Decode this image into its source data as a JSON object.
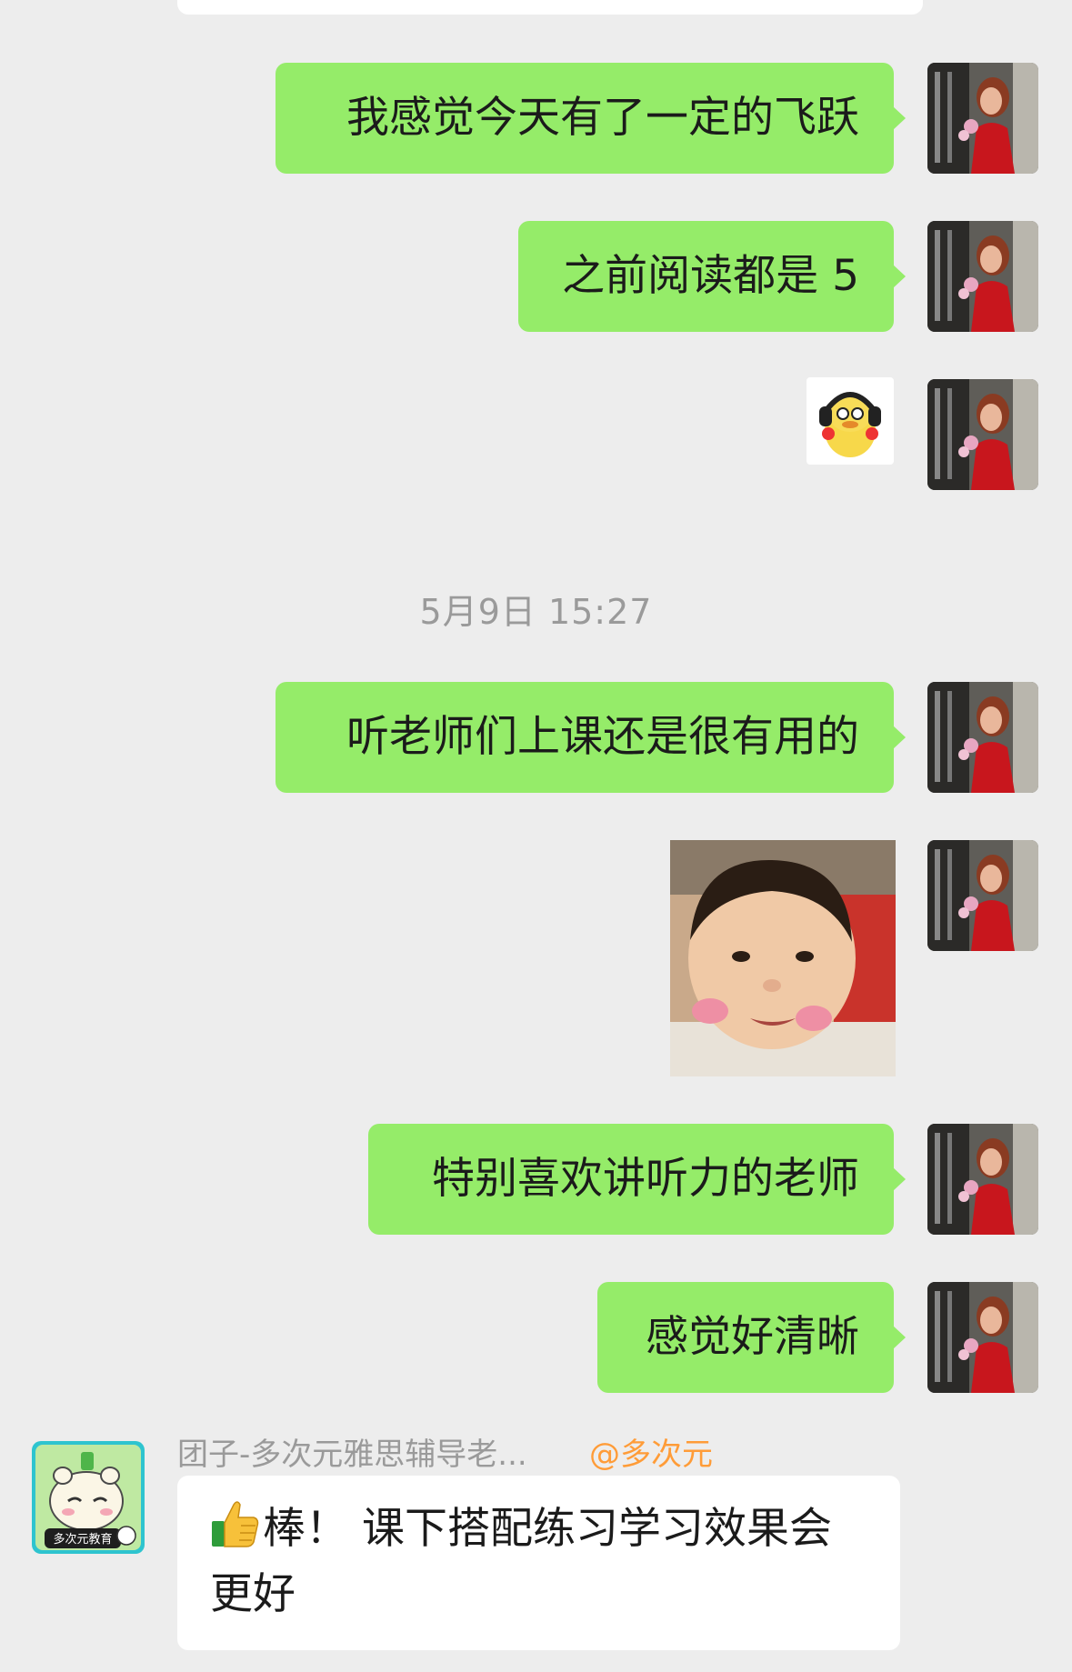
{
  "messages": [
    {
      "text": "我感觉今天有了一定的飞跃"
    },
    {
      "text": "之前阅读都是 5"
    },
    {
      "text": "听老师们上课还是很有用的"
    },
    {
      "text": "特别喜欢讲听力的老师"
    },
    {
      "text": "感觉好清晰"
    }
  ],
  "timestamp": "5月9日 15:27",
  "incoming": {
    "sender_name": "团子-多次元雅思辅导老...",
    "sender_tag": "@多次元",
    "avatar_text": "多次元教育",
    "emoji": "thumbs-up-icon",
    "text": "棒！ 课下搭配练习学习效果会更好"
  },
  "colors": {
    "background": "#ededed",
    "outgoing_bubble": "#95ec69",
    "incoming_bubble": "#ffffff",
    "timestamp": "#9a9a9a",
    "tag": "#ff9c38"
  }
}
